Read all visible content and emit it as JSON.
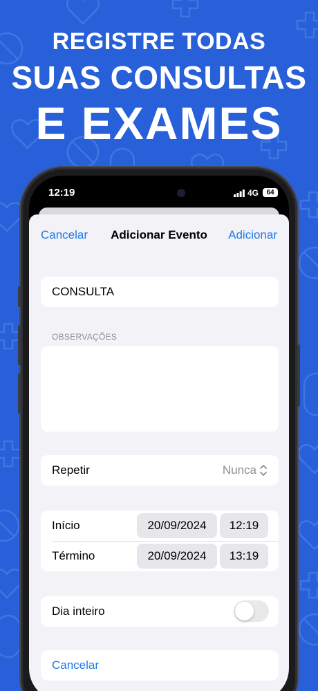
{
  "promo": {
    "line1": "REGISTRE TODAS",
    "line2": "SUAS CONSULTAS",
    "line3": "E EXAMES"
  },
  "status_bar": {
    "time": "12:19",
    "network": "4G",
    "battery": "64"
  },
  "nav": {
    "cancel_label": "Cancelar",
    "title": "Adicionar Evento",
    "add_label": "Adicionar"
  },
  "form": {
    "title_value": "CONSULTA",
    "observations_label": "OBSERVAÇÕES",
    "observations_value": "",
    "repeat": {
      "label": "Repetir",
      "value": "Nunca"
    },
    "start": {
      "label": "Início",
      "date": "20/09/2024",
      "time": "12:19"
    },
    "end": {
      "label": "Término",
      "date": "20/09/2024",
      "time": "13:19"
    },
    "all_day": {
      "label": "Dia inteiro",
      "on": false
    },
    "cancel_label": "Cancelar"
  },
  "colors": {
    "background": "#2760d8",
    "accent": "#1c7aea",
    "sheet": "#f2f2f7"
  },
  "icons": {
    "pattern": [
      "heart-icon",
      "plus-icon",
      "pill-icon",
      "tablet-icon"
    ],
    "repeat_chevron": "chevron-up-down-icon",
    "signal": "signal-bars-icon"
  }
}
